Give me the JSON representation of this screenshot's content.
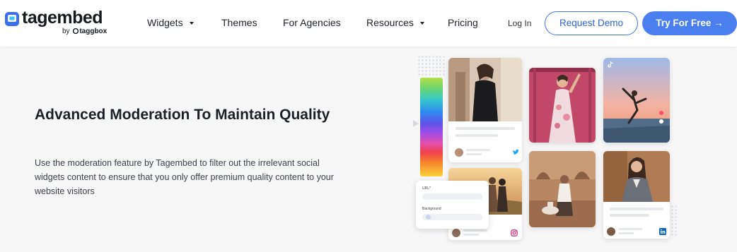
{
  "header": {
    "logo": {
      "name": "tagembed",
      "by": "by",
      "brand": "taggbox"
    },
    "nav": [
      {
        "label": "Widgets",
        "dropdown": true
      },
      {
        "label": "Themes",
        "dropdown": false
      },
      {
        "label": "For Agencies",
        "dropdown": false
      },
      {
        "label": "Resources",
        "dropdown": true
      },
      {
        "label": "Pricing",
        "dropdown": false
      }
    ],
    "login": "Log In",
    "demo_button": "Request Demo",
    "try_button": "Try For Free →"
  },
  "hero": {
    "title": "Advanced Moderation To Maintain Quality",
    "description": "Use the moderation feature by Tagembed to filter out the irrelevant social widgets content to ensure that you only offer premium quality content to your website visitors"
  },
  "illustration": {
    "form": {
      "url_label": "URL*",
      "background_label": "Background"
    }
  },
  "colors": {
    "accent": "#4b7ff0",
    "accent_text": "#2f63d6",
    "background": "#f7f7f8"
  }
}
